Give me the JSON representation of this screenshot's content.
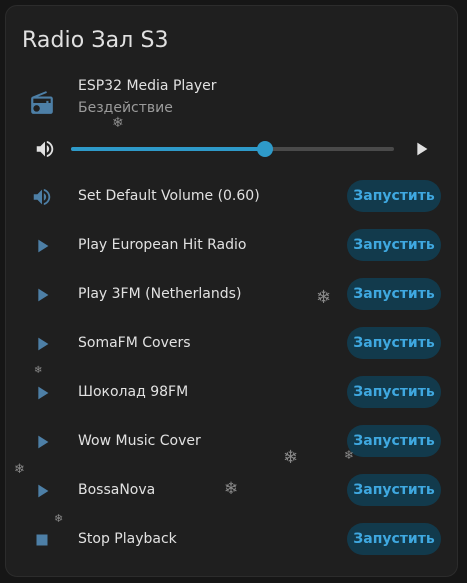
{
  "card": {
    "title": "Radio Зал S3"
  },
  "player": {
    "name": "ESP32 Media Player",
    "state": "Бездействие",
    "icon": "radio-icon",
    "volume_level": 0.6
  },
  "scripts": [
    {
      "label": "Set Default Volume (0.60)",
      "icon": "volume-icon",
      "button": "Запустить"
    },
    {
      "label": "Play European Hit Radio",
      "icon": "play-icon",
      "button": "Запустить"
    },
    {
      "label": "Play 3FM (Netherlands)",
      "icon": "play-icon",
      "button": "Запустить"
    },
    {
      "label": "SomaFM Covers",
      "icon": "play-icon",
      "button": "Запустить"
    },
    {
      "label": "Шоколад 98FM",
      "icon": "play-icon",
      "button": "Запустить"
    },
    {
      "label": "Wow Music Cover",
      "icon": "play-icon",
      "button": "Запустить"
    },
    {
      "label": "BossaNova",
      "icon": "play-icon",
      "button": "Запустить"
    },
    {
      "label": "Stop Playback",
      "icon": "stop-icon",
      "button": "Запустить"
    }
  ],
  "colors": {
    "accent": "#2e9ac9",
    "icon": "#4d7fa6",
    "button_bg": "#123a4c",
    "button_text": "#3fa8e0",
    "card_bg": "#1f1f1f",
    "page_bg": "#161616"
  }
}
